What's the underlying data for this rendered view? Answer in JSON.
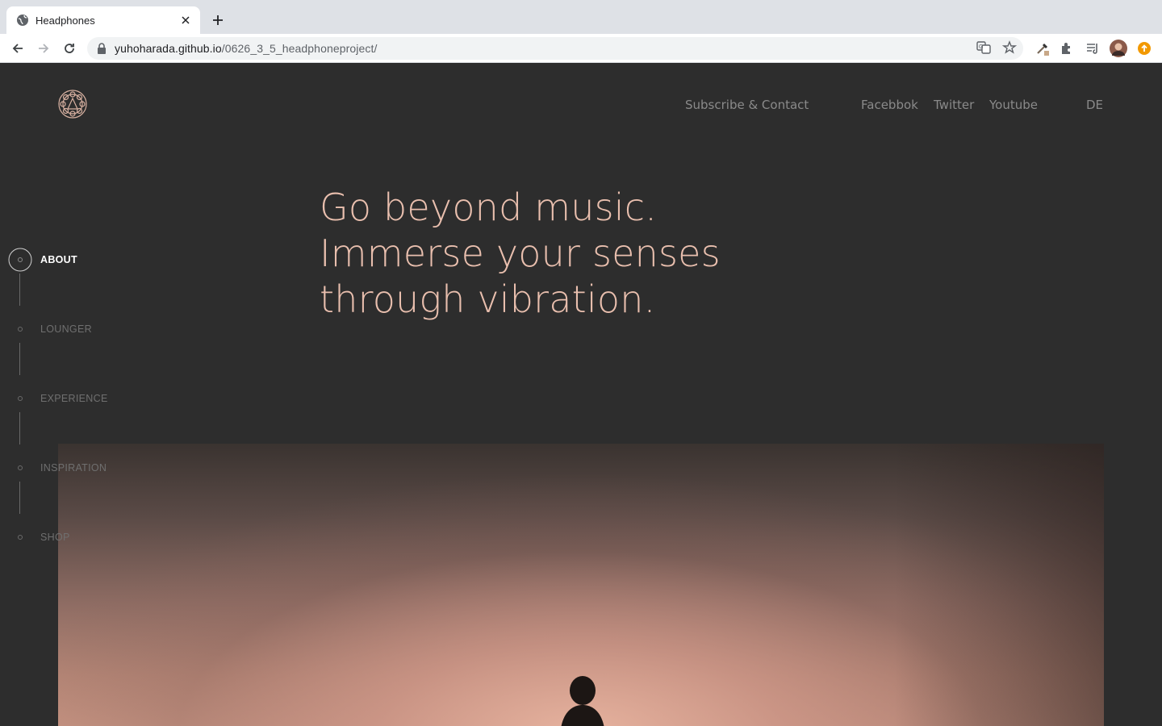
{
  "browser": {
    "tab_title": "Headphones",
    "url_host": "yuhoharada.github.io",
    "url_path": "/0626_3_5_headphoneproject/"
  },
  "header": {
    "nav": {
      "subscribe": "Subscribe & Contact",
      "facebook": "Facebbok",
      "twitter": "Twitter",
      "youtube": "Youtube",
      "language": "DE"
    }
  },
  "hero": {
    "line1": "Go beyond music.",
    "line2": "Immerse your senses",
    "line3": "through vibration."
  },
  "sidenav": {
    "items": [
      {
        "label": "ABOUT",
        "active": true
      },
      {
        "label": "LOUNGER",
        "active": false
      },
      {
        "label": "EXPERIENCE",
        "active": false
      },
      {
        "label": "INSPIRATION",
        "active": false
      },
      {
        "label": "SHOP",
        "active": false
      }
    ]
  },
  "colors": {
    "page_bg": "#2d2d2d",
    "accent_peach": "#e9bfae",
    "nav_text": "#8a8a8a",
    "active_nav": "#ffffff"
  }
}
